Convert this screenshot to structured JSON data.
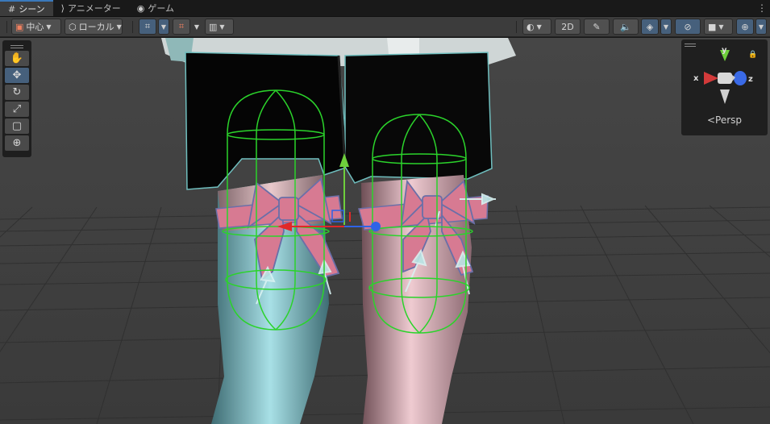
{
  "tabs": [
    {
      "label": "シーン",
      "icon": "grid-icon"
    },
    {
      "label": "アニメーター",
      "icon": "animator-icon"
    },
    {
      "label": "ゲーム",
      "icon": "gamepad-icon"
    }
  ],
  "toolbar": {
    "pivot_label": "中心",
    "space_label": "ローカル",
    "mode_2d_label": "2D"
  },
  "gizmo": {
    "x_label": "x",
    "y_label": "y",
    "z_label": "z",
    "projection_label": "Persp"
  },
  "colors": {
    "accent": "#46607c",
    "collider": "#2bd32b",
    "ribbon": "#d77a92",
    "axis_x": "#e02828",
    "axis_y": "#6ecf3c",
    "axis_z": "#2f63e6"
  }
}
